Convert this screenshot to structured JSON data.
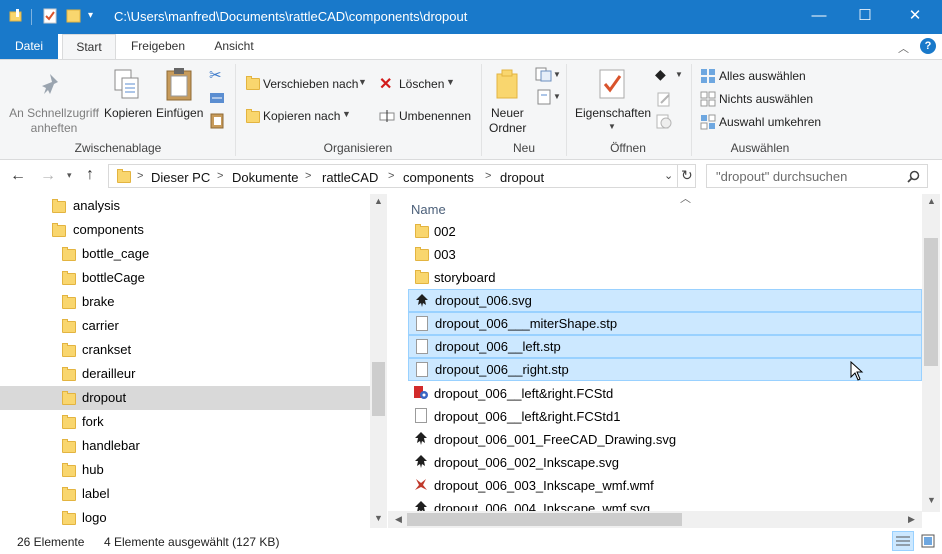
{
  "window": {
    "title": "C:\\Users\\manfred\\Documents\\rattleCAD\\components\\dropout",
    "accent": "#1979ca"
  },
  "ribbon_tabs": [
    "Datei",
    "Start",
    "Freigeben",
    "Ansicht"
  ],
  "ribbon": {
    "clipboard": {
      "pin_label_1": "An Schnellzugriff",
      "pin_label_2": "anheften",
      "copy": "Kopieren",
      "paste": "Einfügen",
      "group": "Zwischenablage"
    },
    "organize": {
      "move_to": "Verschieben nach",
      "copy_to": "Kopieren nach",
      "delete": "Löschen",
      "rename": "Umbenennen",
      "group": "Organisieren"
    },
    "new": {
      "new_folder_1": "Neuer",
      "new_folder_2": "Ordner",
      "group": "Neu"
    },
    "open": {
      "properties": "Eigenschaften",
      "group": "Öffnen"
    },
    "select": {
      "select_all": "Alles auswählen",
      "select_none": "Nichts auswählen",
      "invert": "Auswahl umkehren",
      "group": "Auswählen"
    }
  },
  "address": {
    "crumbs": [
      "Dieser PC",
      "Dokumente",
      "rattleCAD",
      "components",
      "dropout"
    ],
    "search_placeholder": "\"dropout\" durchsuchen"
  },
  "nav_tree": [
    {
      "label": "analysis",
      "level": 1
    },
    {
      "label": "components",
      "level": 1
    },
    {
      "label": "bottle_cage",
      "level": 2
    },
    {
      "label": "bottleCage",
      "level": 2
    },
    {
      "label": "brake",
      "level": 2
    },
    {
      "label": "carrier",
      "level": 2
    },
    {
      "label": "crankset",
      "level": 2
    },
    {
      "label": "derailleur",
      "level": 2
    },
    {
      "label": "dropout",
      "level": 2,
      "selected": true
    },
    {
      "label": "fork",
      "level": 2
    },
    {
      "label": "handlebar",
      "level": 2
    },
    {
      "label": "hub",
      "level": 2
    },
    {
      "label": "label",
      "level": 2
    },
    {
      "label": "logo",
      "level": 2
    }
  ],
  "files": {
    "column_header": "Name",
    "items": [
      {
        "name": "002",
        "icon": "folder-icon",
        "selected": false
      },
      {
        "name": "003",
        "icon": "folder-icon",
        "selected": false
      },
      {
        "name": "storyboard",
        "icon": "folder-icon",
        "selected": false
      },
      {
        "name": "dropout_006.svg",
        "icon": "inkscape-icon",
        "selected": true
      },
      {
        "name": "dropout_006___miterShape.stp",
        "icon": "file-icon",
        "selected": true
      },
      {
        "name": "dropout_006__left.stp",
        "icon": "file-icon",
        "selected": true
      },
      {
        "name": "dropout_006__right.stp",
        "icon": "file-icon",
        "selected": true
      },
      {
        "name": "dropout_006__left&right.FCStd",
        "icon": "freecad-icon",
        "selected": false
      },
      {
        "name": "dropout_006__left&right.FCStd1",
        "icon": "file-icon",
        "selected": false
      },
      {
        "name": "dropout_006_001_FreeCAD_Drawing.svg",
        "icon": "inkscape-icon",
        "selected": false
      },
      {
        "name": "dropout_006_002_Inkscape.svg",
        "icon": "inkscape-icon",
        "selected": false
      },
      {
        "name": "dropout_006_003_Inkscape_wmf.wmf",
        "icon": "wmf-icon",
        "selected": false
      },
      {
        "name": "dropout_006_004_Inkscape_wmf.svg",
        "icon": "inkscape-icon",
        "selected": false
      }
    ]
  },
  "status": {
    "count": "26 Elemente",
    "selection": "4 Elemente ausgewählt (127 KB)"
  }
}
